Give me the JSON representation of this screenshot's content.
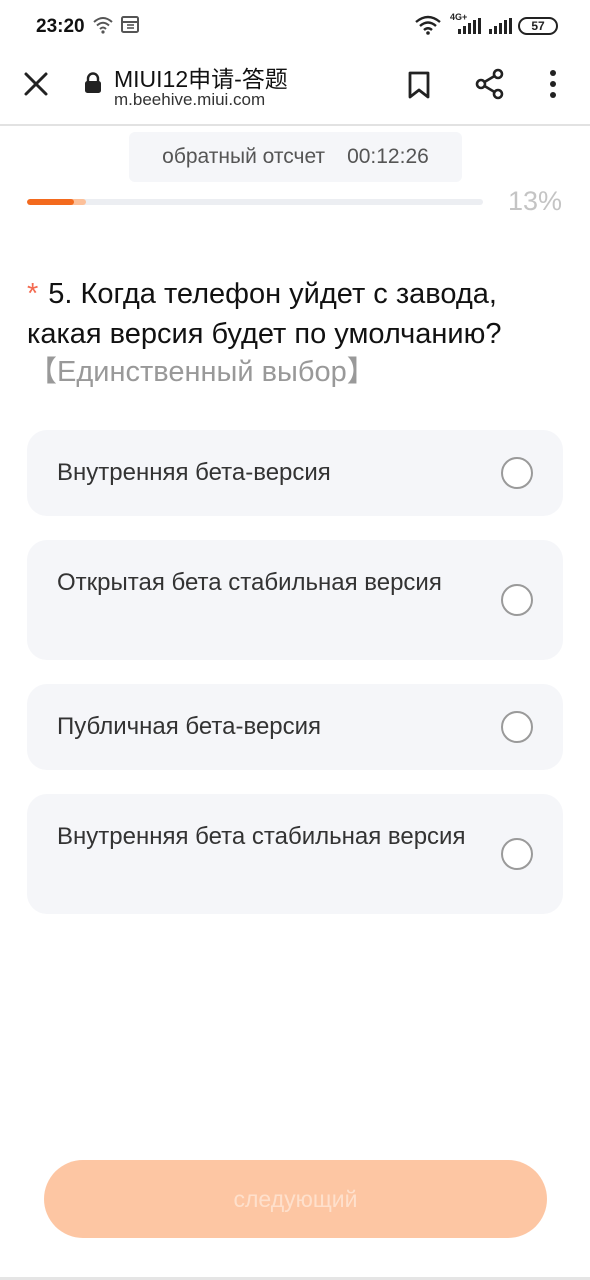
{
  "status_bar": {
    "time": "23:20",
    "network": "4G+",
    "battery": "57",
    "icons": [
      "wifi-icon",
      "screen-icon",
      "signal-icon",
      "battery-icon"
    ]
  },
  "browser": {
    "title": "MIUI12申请-答题",
    "url": "m.beehive.miui.com",
    "icons": [
      "close-icon",
      "lock-icon",
      "bookmark-icon",
      "share-icon",
      "more-icon"
    ]
  },
  "quiz": {
    "countdown_label": "обратный отсчет",
    "countdown_time": "00:12:26",
    "progress_percent": 13,
    "progress_text": "13%",
    "question_marker": "*",
    "question_text": "5. Когда телефон уйдет с завода, какая версия будет по умолчанию?",
    "question_type": "【Единственный выбор】",
    "options": [
      {
        "label": "Внутренняя бета-версия",
        "selected": false
      },
      {
        "label": "Открытая бета стабильная версия",
        "selected": false
      },
      {
        "label": "Публичная бета-версия",
        "selected": false
      },
      {
        "label": "Внутренняя бета стабильная версия",
        "selected": false
      }
    ],
    "next_label": "следующий"
  },
  "colors": {
    "accent": "#f36a1e",
    "button_disabled": "#fdc6a3",
    "option_bg": "#f5f6f9",
    "asterisk": "#f36a50"
  }
}
